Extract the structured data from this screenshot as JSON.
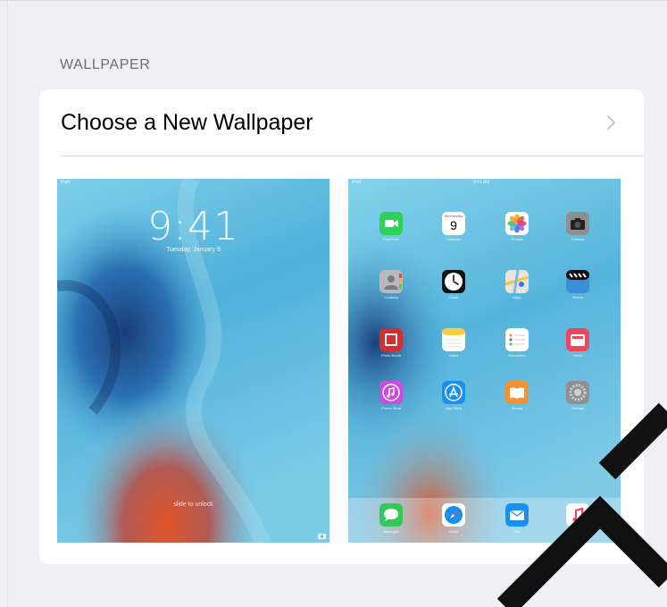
{
  "section": {
    "header": "WALLPAPER"
  },
  "row": {
    "label": "Choose a New Wallpaper"
  },
  "lock_screen": {
    "status_left": "iPad",
    "time": "9:41",
    "date": "Tuesday, January 9",
    "unlock_hint": "slide to unlock"
  },
  "home_screen": {
    "status_left": "iPad",
    "status_time": "9:41 AM",
    "apps": [
      {
        "label": "FaceTime"
      },
      {
        "label": "Calendar"
      },
      {
        "label": "Photos"
      },
      {
        "label": "Camera"
      },
      {
        "label": "Contacts"
      },
      {
        "label": "Clock"
      },
      {
        "label": "Maps"
      },
      {
        "label": "Videos"
      },
      {
        "label": "Photo Booth"
      },
      {
        "label": "Notes"
      },
      {
        "label": "Reminders"
      },
      {
        "label": "News"
      },
      {
        "label": "iTunes Store"
      },
      {
        "label": "App Store"
      },
      {
        "label": "iBooks"
      },
      {
        "label": "Settings"
      }
    ],
    "calendar_day": "Wednesday",
    "calendar_date": "9",
    "dock": [
      {
        "label": "Messages"
      },
      {
        "label": "Safari"
      },
      {
        "label": "Mail"
      },
      {
        "label": "Music"
      }
    ]
  },
  "colors": {
    "background": "#efeff4",
    "card": "#ffffff",
    "header_text": "#6d6d72",
    "chevron": "#c7c7cc"
  }
}
